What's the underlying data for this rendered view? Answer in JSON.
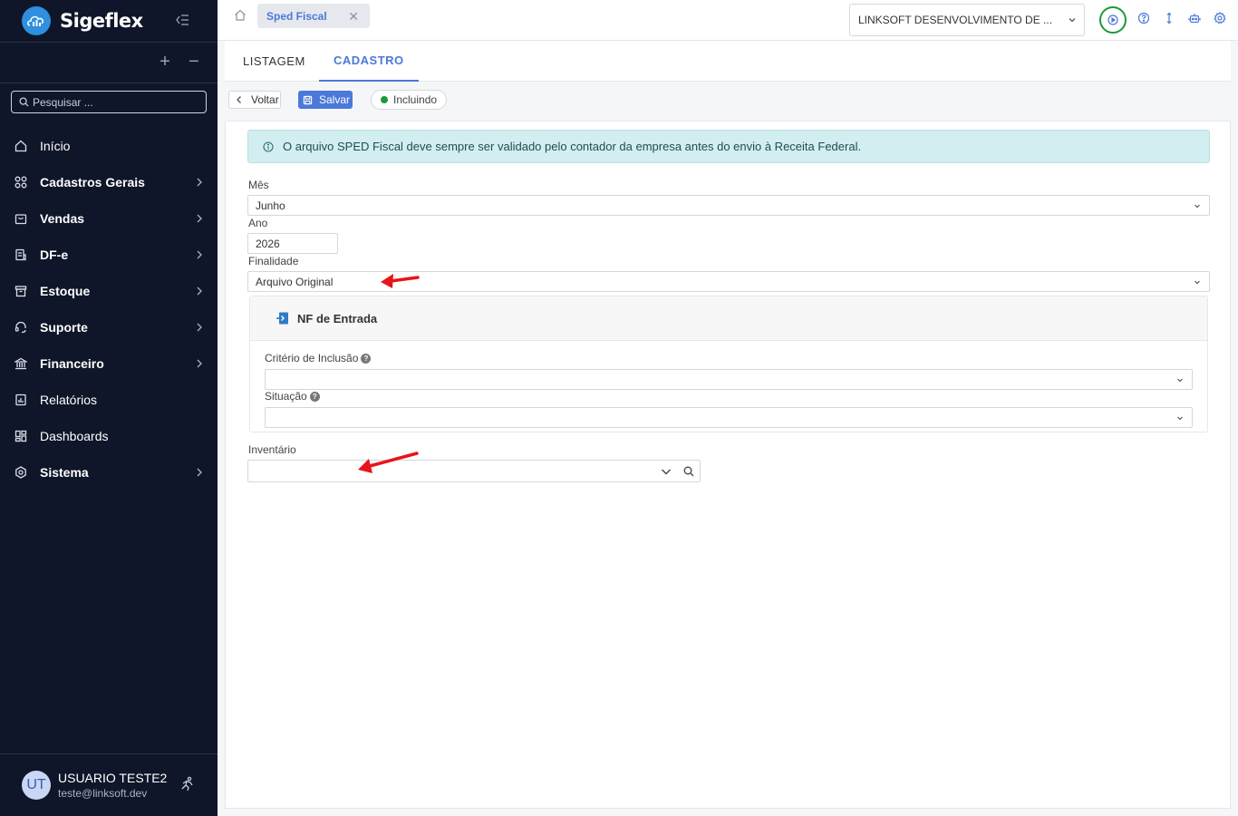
{
  "app": {
    "name": "Sigeflex"
  },
  "sidebar": {
    "search_placeholder": "Pesquisar ...",
    "items": [
      {
        "label": "Início",
        "icon": "home-icon",
        "bold": false,
        "chevron": false
      },
      {
        "label": "Cadastros Gerais",
        "icon": "grid-icon",
        "bold": true,
        "chevron": true
      },
      {
        "label": "Vendas",
        "icon": "bag-icon",
        "bold": true,
        "chevron": true
      },
      {
        "label": "DF-e",
        "icon": "document-icon",
        "bold": true,
        "chevron": true
      },
      {
        "label": "Estoque",
        "icon": "archive-icon",
        "bold": true,
        "chevron": true
      },
      {
        "label": "Suporte",
        "icon": "headset-icon",
        "bold": true,
        "chevron": true
      },
      {
        "label": "Financeiro",
        "icon": "bank-icon",
        "bold": true,
        "chevron": true
      },
      {
        "label": "Relatórios",
        "icon": "report-icon",
        "bold": false,
        "chevron": false
      },
      {
        "label": "Dashboards",
        "icon": "dashboard-icon",
        "bold": false,
        "chevron": false
      },
      {
        "label": "Sistema",
        "icon": "gear-icon",
        "bold": true,
        "chevron": true
      }
    ],
    "user": {
      "initials": "UT",
      "name": "USUARIO TESTE2",
      "email": "teste@linksoft.dev"
    }
  },
  "topbar": {
    "open_tab": "Sped Fiscal",
    "company": "LINKSOFT DESENVOLVIMENTO DE ...",
    "icons": [
      "play-icon",
      "help-icon",
      "sort-icon",
      "robot-icon",
      "gear-icon"
    ]
  },
  "tabs": {
    "listagem": "LISTAGEM",
    "cadastro": "CADASTRO"
  },
  "toolbar": {
    "back_label": "Voltar",
    "save_label": "Salvar",
    "status": "Incluindo",
    "status_color": "#1a9a3a"
  },
  "form": {
    "alert": "O arquivo SPED Fiscal deve sempre ser validado pelo contador da empresa antes do envio à Receita Federal.",
    "mes": {
      "label": "Mês",
      "value": "Junho"
    },
    "ano": {
      "label": "Ano",
      "value": "2026"
    },
    "finalidade": {
      "label": "Finalidade",
      "value": "Arquivo Original"
    },
    "nf_entrada": {
      "title": "NF de Entrada",
      "criterio": {
        "label": "Critério de Inclusão",
        "value": ""
      },
      "situacao": {
        "label": "Situação",
        "value": ""
      }
    },
    "inventario": {
      "label": "Inventário",
      "value": ""
    }
  },
  "colors": {
    "sidebar_bg": "#0f1629",
    "accent": "#4a79d9",
    "alert_bg": "#d3eef0",
    "annotation_arrow": "#e8141b"
  }
}
